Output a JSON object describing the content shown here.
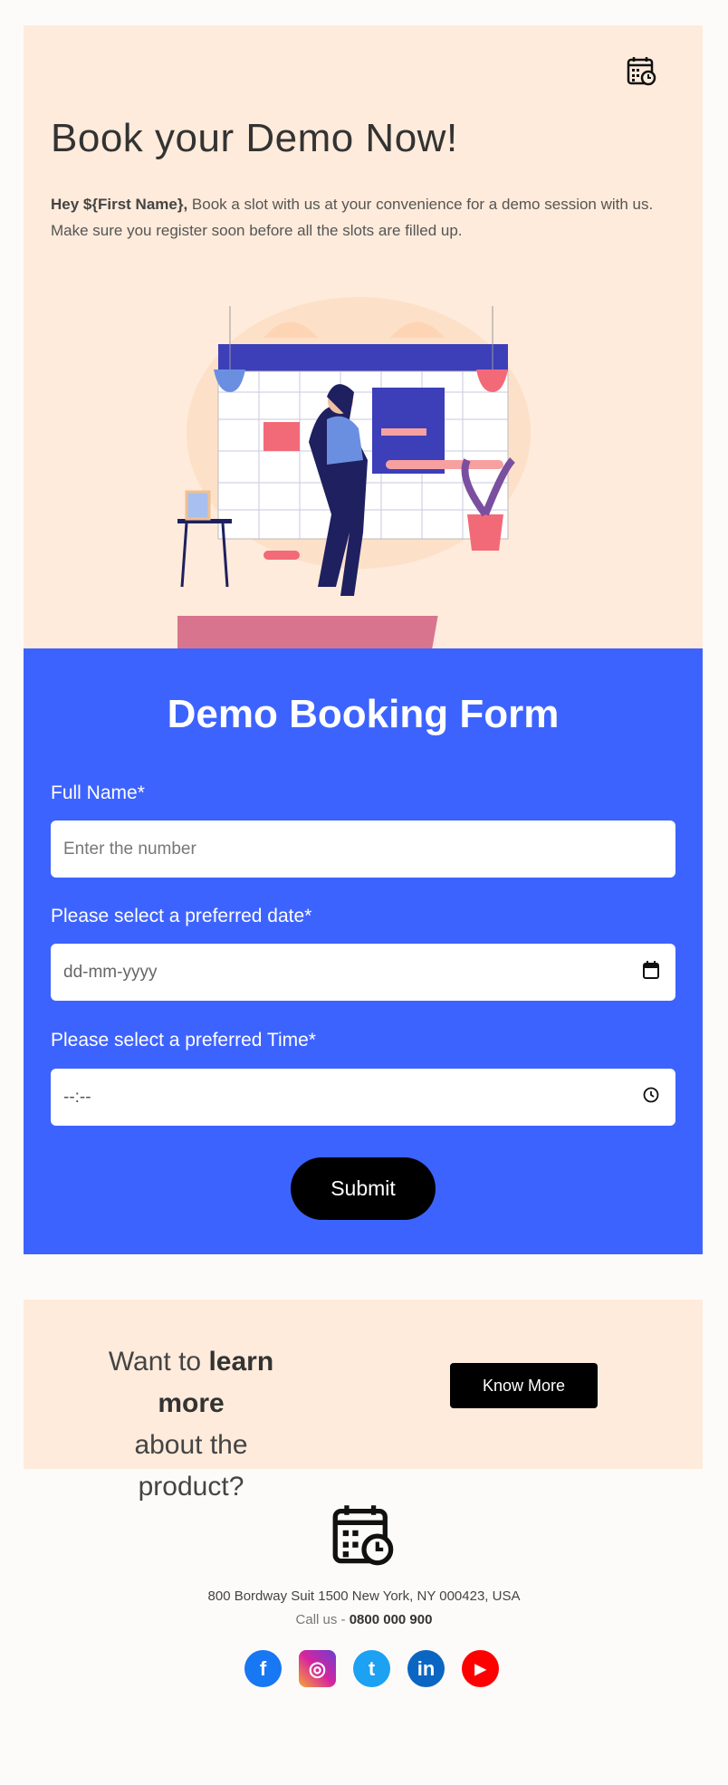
{
  "hero": {
    "title": "Book your Demo Now!",
    "greeting": "Hey ${First Name},",
    "text": " Book a slot with us at your convenience for a demo session with us. Make sure you register soon before all the slots are filled up.",
    "icon": "calendar-clock-icon",
    "bg": "#feebdb"
  },
  "form": {
    "title": "Demo Booking Form",
    "bg": "#3d63ff",
    "fields": [
      {
        "label": "Full Name*",
        "placeholder": "Enter the number"
      },
      {
        "label": "Please select a preferred date*",
        "placeholder": "dd-mm-yyyy",
        "icon": "calendar-icon"
      },
      {
        "label": "Please select a preferred Time*",
        "placeholder": "--:--",
        "icon": "clock-icon"
      }
    ],
    "submit": "Submit"
  },
  "cta": {
    "line1_a": "Want to ",
    "line1_b": "learn more",
    "line2": "about the product?",
    "button": "Know More"
  },
  "footer": {
    "address": "800 Bordway Suit 1500 New York, NY 000423, USA",
    "call_label": "Call us - ",
    "phone": "0800 000 900",
    "social": [
      {
        "name": "facebook",
        "glyph": "f",
        "color": "#1877f2"
      },
      {
        "name": "instagram",
        "glyph": "◎",
        "color": "#d6249f"
      },
      {
        "name": "twitter",
        "glyph": "t",
        "color": "#1da1f2"
      },
      {
        "name": "linkedin",
        "glyph": "in",
        "color": "#0a66c2"
      },
      {
        "name": "youtube",
        "glyph": "▶",
        "color": "#ff0000"
      }
    ]
  }
}
